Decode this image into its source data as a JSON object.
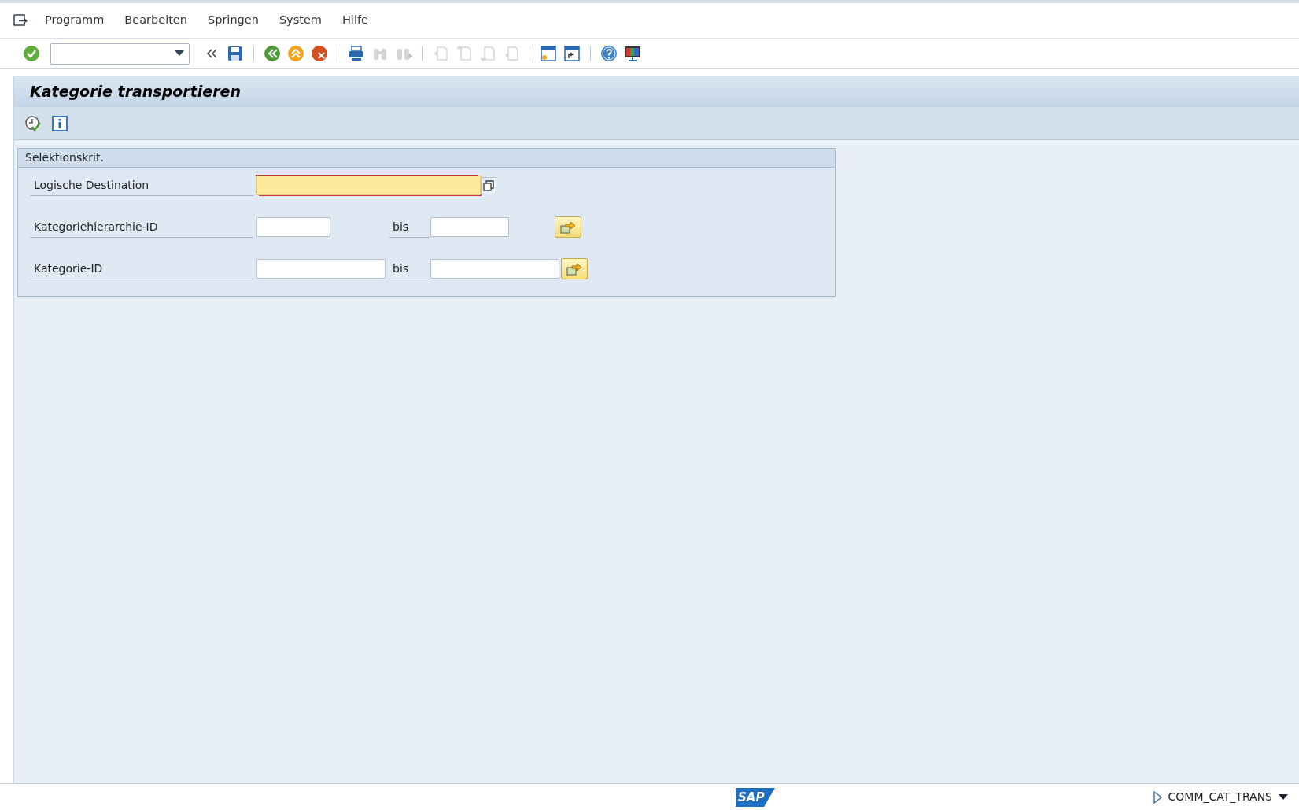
{
  "menu": [
    {
      "label": "Programm"
    },
    {
      "label": "Bearbeiten"
    },
    {
      "label": "Springen"
    },
    {
      "label": "System"
    },
    {
      "label": "Hilfe"
    }
  ],
  "toolbar": [
    {
      "kind": "enter",
      "disabled": false
    },
    {
      "kind": "command-field"
    },
    {
      "kind": "collapse",
      "disabled": false
    },
    {
      "kind": "save",
      "disabled": false
    },
    {
      "kind": "separator"
    },
    {
      "kind": "back",
      "disabled": false
    },
    {
      "kind": "exit",
      "disabled": false
    },
    {
      "kind": "cancel",
      "disabled": false
    },
    {
      "kind": "separator"
    },
    {
      "kind": "print",
      "disabled": false
    },
    {
      "kind": "find",
      "disabled": true
    },
    {
      "kind": "find-next",
      "disabled": true
    },
    {
      "kind": "separator"
    },
    {
      "kind": "first-page",
      "disabled": true
    },
    {
      "kind": "previous-page",
      "disabled": true
    },
    {
      "kind": "next-page",
      "disabled": true
    },
    {
      "kind": "last-page",
      "disabled": true
    },
    {
      "kind": "separator"
    },
    {
      "kind": "new-session",
      "disabled": false
    },
    {
      "kind": "shortcut",
      "disabled": false
    },
    {
      "kind": "separator"
    },
    {
      "kind": "help",
      "disabled": false
    },
    {
      "kind": "layout",
      "disabled": false
    }
  ],
  "title": "Kategorie transportieren",
  "app_toolbar": [
    {
      "kind": "execute"
    },
    {
      "kind": "info"
    }
  ],
  "group": {
    "title": "Selektionskrit.",
    "rows": [
      {
        "kind": "single",
        "label": "Logische Destination",
        "fields": [
          {
            "focused": true
          }
        ]
      },
      {
        "kind": "range",
        "label": "Kategoriehierarchie-ID",
        "separator": "bis",
        "fields": [
          {
            "focused": false
          },
          {
            "focused": false
          }
        ]
      },
      {
        "kind": "range",
        "label": "Kategorie-ID",
        "separator": "bis",
        "fields": [
          {
            "focused": false
          },
          {
            "focused": false
          }
        ]
      }
    ]
  },
  "status_bar": {
    "logo": "SAP",
    "transaction": "COMM_CAT_TRANS"
  }
}
